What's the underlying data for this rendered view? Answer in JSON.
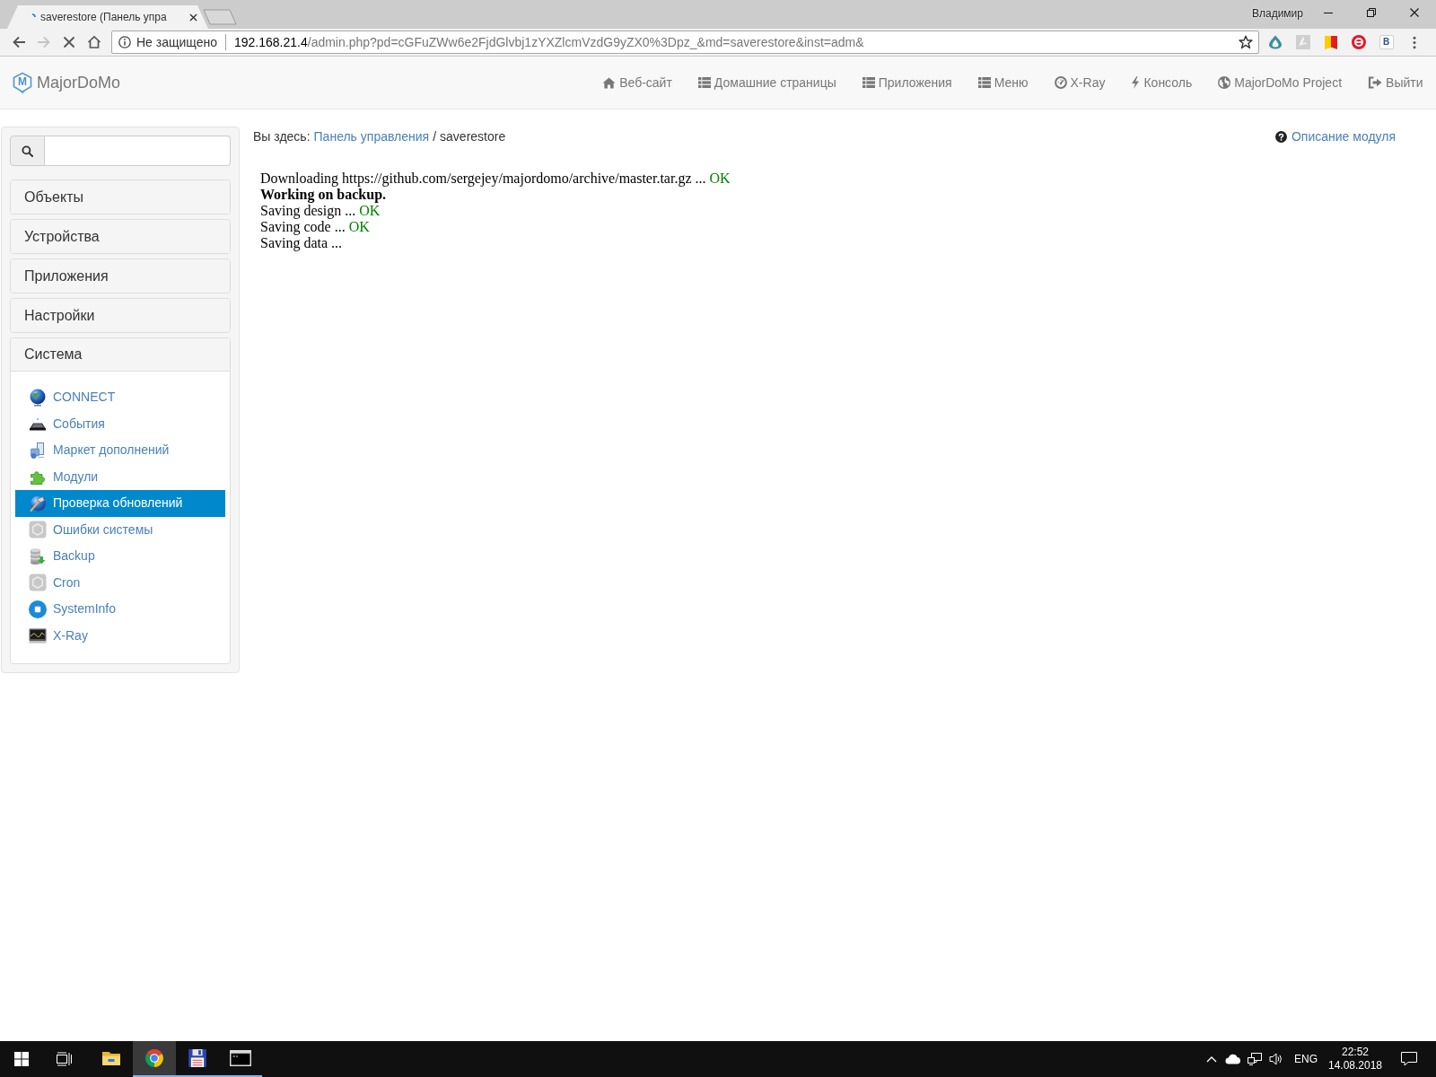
{
  "browser": {
    "tabs": [
      {
        "title": "saverestore (Панель упра",
        "selected": true
      }
    ],
    "user": "Владимир",
    "forward_disabled": true,
    "loading": true,
    "security_label": "Не защищено",
    "url_host": "192.168.21.4",
    "url_path": "/admin.php?pd=cGFuZWw6e2FjdGlvbj1zYXZlcmVzdG9yZX0%3Dpz_&md=saverestore&inst=adm&",
    "extension_letter": "B"
  },
  "navbar": {
    "logo_letter": "M",
    "brand": "MajorDoMo",
    "items": [
      "Веб-сайт",
      "Домашние страницы",
      "Приложения",
      "Меню",
      "X-Ray",
      "Консоль",
      "MajorDoMo Project",
      "Выйти"
    ]
  },
  "sidebar": {
    "panels": [
      {
        "title": "Объекты",
        "expanded": false
      },
      {
        "title": "Устройства",
        "expanded": false
      },
      {
        "title": "Приложения",
        "expanded": false
      },
      {
        "title": "Настройки",
        "expanded": false
      },
      {
        "title": "Система",
        "expanded": true,
        "items": [
          {
            "label": "CONNECT",
            "selected": false
          },
          {
            "label": "События",
            "selected": false
          },
          {
            "label": "Маркет дополнений",
            "selected": false
          },
          {
            "label": "Модули",
            "selected": false
          },
          {
            "label": "Проверка обновлений",
            "selected": true
          },
          {
            "label": "Ошибки системы",
            "selected": false
          },
          {
            "label": "Backup",
            "selected": false
          },
          {
            "label": "Cron",
            "selected": false
          },
          {
            "label": "SystemInfo",
            "selected": false
          },
          {
            "label": "X-Ray",
            "selected": false
          }
        ]
      }
    ]
  },
  "breadcrumb": {
    "prefix": "Вы здесь:",
    "link": "Панель управления",
    "separator": "/",
    "current": "saverestore"
  },
  "help_link": "Описание модуля",
  "output": [
    {
      "text": "Downloading https://github.com/sergejey/majordomo/archive/master.tar.gz ...",
      "status": "OK",
      "bold": false
    },
    {
      "text": "Working on backup.",
      "bold": true
    },
    {
      "text": "Saving design ...",
      "status": "OK",
      "bold": false
    },
    {
      "text": "Saving code ...",
      "status": "OK",
      "bold": false
    },
    {
      "text": "Saving data ...",
      "bold": false
    }
  ],
  "taskbar": {
    "apps": [
      {
        "running": false,
        "selected": false
      },
      {
        "running": true,
        "selected": true
      },
      {
        "running": true,
        "selected": false
      },
      {
        "running": true,
        "selected": false
      }
    ],
    "language": "ENG",
    "time": "22:52",
    "date": "14.08.2018"
  }
}
